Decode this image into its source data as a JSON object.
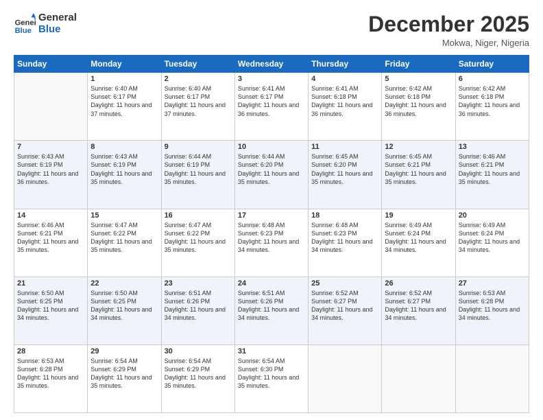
{
  "header": {
    "logo_line1": "General",
    "logo_line2": "Blue",
    "month": "December 2025",
    "location": "Mokwa, Niger, Nigeria"
  },
  "days_of_week": [
    "Sunday",
    "Monday",
    "Tuesday",
    "Wednesday",
    "Thursday",
    "Friday",
    "Saturday"
  ],
  "weeks": [
    [
      {
        "day": "",
        "sunrise": "",
        "sunset": "",
        "daylight": ""
      },
      {
        "day": "1",
        "sunrise": "Sunrise: 6:40 AM",
        "sunset": "Sunset: 6:17 PM",
        "daylight": "Daylight: 11 hours and 37 minutes."
      },
      {
        "day": "2",
        "sunrise": "Sunrise: 6:40 AM",
        "sunset": "Sunset: 6:17 PM",
        "daylight": "Daylight: 11 hours and 37 minutes."
      },
      {
        "day": "3",
        "sunrise": "Sunrise: 6:41 AM",
        "sunset": "Sunset: 6:17 PM",
        "daylight": "Daylight: 11 hours and 36 minutes."
      },
      {
        "day": "4",
        "sunrise": "Sunrise: 6:41 AM",
        "sunset": "Sunset: 6:18 PM",
        "daylight": "Daylight: 11 hours and 36 minutes."
      },
      {
        "day": "5",
        "sunrise": "Sunrise: 6:42 AM",
        "sunset": "Sunset: 6:18 PM",
        "daylight": "Daylight: 11 hours and 36 minutes."
      },
      {
        "day": "6",
        "sunrise": "Sunrise: 6:42 AM",
        "sunset": "Sunset: 6:18 PM",
        "daylight": "Daylight: 11 hours and 36 minutes."
      }
    ],
    [
      {
        "day": "7",
        "sunrise": "Sunrise: 6:43 AM",
        "sunset": "Sunset: 6:19 PM",
        "daylight": "Daylight: 11 hours and 36 minutes."
      },
      {
        "day": "8",
        "sunrise": "Sunrise: 6:43 AM",
        "sunset": "Sunset: 6:19 PM",
        "daylight": "Daylight: 11 hours and 35 minutes."
      },
      {
        "day": "9",
        "sunrise": "Sunrise: 6:44 AM",
        "sunset": "Sunset: 6:19 PM",
        "daylight": "Daylight: 11 hours and 35 minutes."
      },
      {
        "day": "10",
        "sunrise": "Sunrise: 6:44 AM",
        "sunset": "Sunset: 6:20 PM",
        "daylight": "Daylight: 11 hours and 35 minutes."
      },
      {
        "day": "11",
        "sunrise": "Sunrise: 6:45 AM",
        "sunset": "Sunset: 6:20 PM",
        "daylight": "Daylight: 11 hours and 35 minutes."
      },
      {
        "day": "12",
        "sunrise": "Sunrise: 6:45 AM",
        "sunset": "Sunset: 6:21 PM",
        "daylight": "Daylight: 11 hours and 35 minutes."
      },
      {
        "day": "13",
        "sunrise": "Sunrise: 6:46 AM",
        "sunset": "Sunset: 6:21 PM",
        "daylight": "Daylight: 11 hours and 35 minutes."
      }
    ],
    [
      {
        "day": "14",
        "sunrise": "Sunrise: 6:46 AM",
        "sunset": "Sunset: 6:21 PM",
        "daylight": "Daylight: 11 hours and 35 minutes."
      },
      {
        "day": "15",
        "sunrise": "Sunrise: 6:47 AM",
        "sunset": "Sunset: 6:22 PM",
        "daylight": "Daylight: 11 hours and 35 minutes."
      },
      {
        "day": "16",
        "sunrise": "Sunrise: 6:47 AM",
        "sunset": "Sunset: 6:22 PM",
        "daylight": "Daylight: 11 hours and 35 minutes."
      },
      {
        "day": "17",
        "sunrise": "Sunrise: 6:48 AM",
        "sunset": "Sunset: 6:23 PM",
        "daylight": "Daylight: 11 hours and 34 minutes."
      },
      {
        "day": "18",
        "sunrise": "Sunrise: 6:48 AM",
        "sunset": "Sunset: 6:23 PM",
        "daylight": "Daylight: 11 hours and 34 minutes."
      },
      {
        "day": "19",
        "sunrise": "Sunrise: 6:49 AM",
        "sunset": "Sunset: 6:24 PM",
        "daylight": "Daylight: 11 hours and 34 minutes."
      },
      {
        "day": "20",
        "sunrise": "Sunrise: 6:49 AM",
        "sunset": "Sunset: 6:24 PM",
        "daylight": "Daylight: 11 hours and 34 minutes."
      }
    ],
    [
      {
        "day": "21",
        "sunrise": "Sunrise: 6:50 AM",
        "sunset": "Sunset: 6:25 PM",
        "daylight": "Daylight: 11 hours and 34 minutes."
      },
      {
        "day": "22",
        "sunrise": "Sunrise: 6:50 AM",
        "sunset": "Sunset: 6:25 PM",
        "daylight": "Daylight: 11 hours and 34 minutes."
      },
      {
        "day": "23",
        "sunrise": "Sunrise: 6:51 AM",
        "sunset": "Sunset: 6:26 PM",
        "daylight": "Daylight: 11 hours and 34 minutes."
      },
      {
        "day": "24",
        "sunrise": "Sunrise: 6:51 AM",
        "sunset": "Sunset: 6:26 PM",
        "daylight": "Daylight: 11 hours and 34 minutes."
      },
      {
        "day": "25",
        "sunrise": "Sunrise: 6:52 AM",
        "sunset": "Sunset: 6:27 PM",
        "daylight": "Daylight: 11 hours and 34 minutes."
      },
      {
        "day": "26",
        "sunrise": "Sunrise: 6:52 AM",
        "sunset": "Sunset: 6:27 PM",
        "daylight": "Daylight: 11 hours and 34 minutes."
      },
      {
        "day": "27",
        "sunrise": "Sunrise: 6:53 AM",
        "sunset": "Sunset: 6:28 PM",
        "daylight": "Daylight: 11 hours and 34 minutes."
      }
    ],
    [
      {
        "day": "28",
        "sunrise": "Sunrise: 6:53 AM",
        "sunset": "Sunset: 6:28 PM",
        "daylight": "Daylight: 11 hours and 35 minutes."
      },
      {
        "day": "29",
        "sunrise": "Sunrise: 6:54 AM",
        "sunset": "Sunset: 6:29 PM",
        "daylight": "Daylight: 11 hours and 35 minutes."
      },
      {
        "day": "30",
        "sunrise": "Sunrise: 6:54 AM",
        "sunset": "Sunset: 6:29 PM",
        "daylight": "Daylight: 11 hours and 35 minutes."
      },
      {
        "day": "31",
        "sunrise": "Sunrise: 6:54 AM",
        "sunset": "Sunset: 6:30 PM",
        "daylight": "Daylight: 11 hours and 35 minutes."
      },
      {
        "day": "",
        "sunrise": "",
        "sunset": "",
        "daylight": ""
      },
      {
        "day": "",
        "sunrise": "",
        "sunset": "",
        "daylight": ""
      },
      {
        "day": "",
        "sunrise": "",
        "sunset": "",
        "daylight": ""
      }
    ]
  ]
}
